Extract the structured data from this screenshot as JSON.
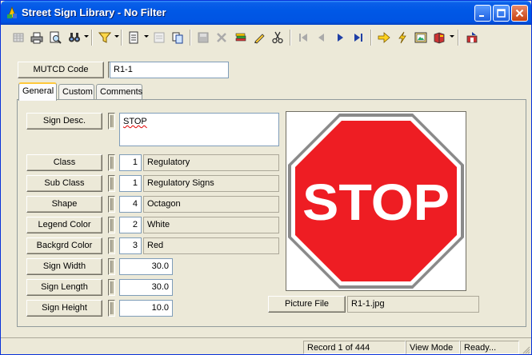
{
  "window": {
    "title": "Street Sign Library - No Filter"
  },
  "header": {
    "code_label": "MUTCD Code",
    "code_value": "R1-1"
  },
  "tabs": [
    {
      "label": "General"
    },
    {
      "label": "Custom"
    },
    {
      "label": "Comments"
    }
  ],
  "form": {
    "sign_desc": {
      "label": "Sign Desc.",
      "value": "STOP"
    },
    "class": {
      "label": "Class",
      "code": "1",
      "text": "Regulatory"
    },
    "sub_class": {
      "label": "Sub Class",
      "code": "1",
      "text": "Regulatory Signs"
    },
    "shape": {
      "label": "Shape",
      "code": "4",
      "text": "Octagon"
    },
    "legend_color": {
      "label": "Legend Color",
      "code": "2",
      "text": "White"
    },
    "backgrd_color": {
      "label": "Backgrd Color",
      "code": "3",
      "text": "Red"
    },
    "sign_width": {
      "label": "Sign Width",
      "value": "30.0"
    },
    "sign_length": {
      "label": "Sign Length",
      "value": "30.0"
    },
    "sign_height": {
      "label": "Sign Height",
      "value": "10.0"
    }
  },
  "picture": {
    "sign_text": "STOP",
    "file_label": "Picture File",
    "file_value": "R1-1.jpg"
  },
  "status": {
    "record": "Record 1 of 444",
    "mode": "View Mode",
    "state": "Ready..."
  },
  "colors": {
    "sign_red": "#ee1d23",
    "title_blue": "#0054e3"
  }
}
